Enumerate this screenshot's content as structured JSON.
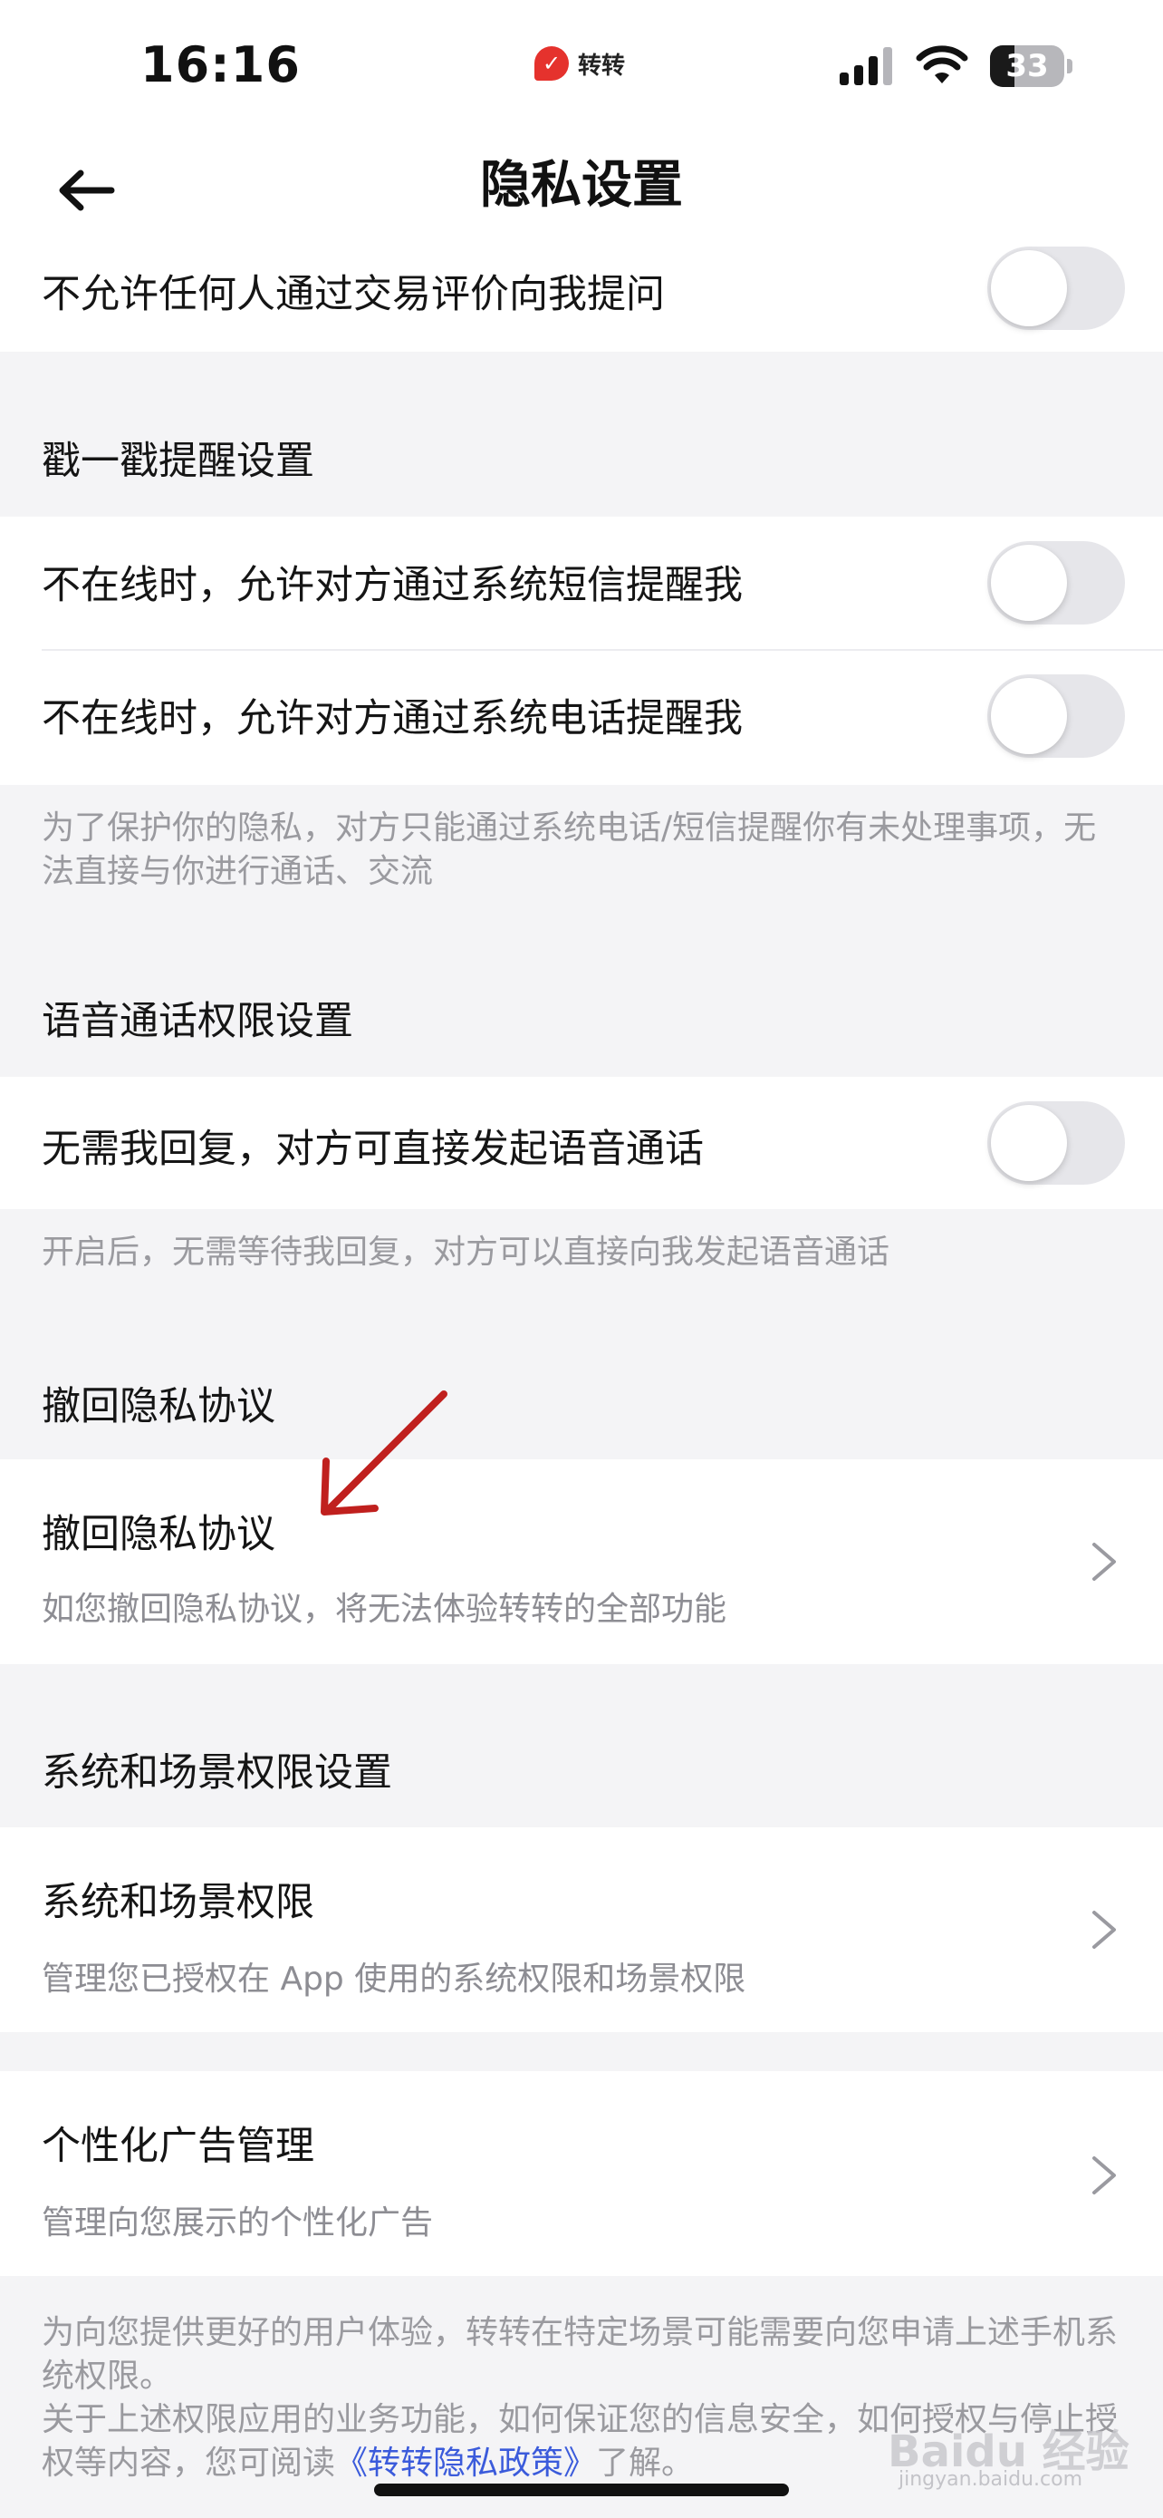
{
  "status_bar": {
    "time": "16:16",
    "app_name": "转转",
    "battery_level": "33",
    "battery_fraction": 0.33
  },
  "header": {
    "title": "隐私设置",
    "back_icon": "arrow-left-icon"
  },
  "rows": {
    "no_question": {
      "label": "不允许任何人通过交易评价向我提问",
      "enabled": false
    },
    "poke_title": "戳一戳提醒设置",
    "sms_remind": {
      "label": "不在线时，允许对方通过系统短信提醒我",
      "enabled": false
    },
    "call_remind": {
      "label": "不在线时，允许对方通过系统电话提醒我",
      "enabled": false
    },
    "poke_note": "为了保护你的隐私，对方只能通过系统电话/短信提醒你有未处理事项，无法直接与你进行通话、交流",
    "voice_title": "语音通话权限设置",
    "voice_call": {
      "label": "无需我回复，对方可直接发起语音通话",
      "enabled": false
    },
    "voice_note": "开启后，无需等待我回复，对方可以直接向我发起语音通话",
    "revoke_title": "撤回隐私协议",
    "revoke": {
      "label": "撤回隐私协议",
      "sub": "如您撤回隐私协议，将无法体验转转的全部功能"
    },
    "system_title": "系统和场景权限设置",
    "system": {
      "label": "系统和场景权限",
      "sub": "管理您已授权在 App 使用的系统权限和场景权限"
    },
    "ads": {
      "label": "个性化广告管理",
      "sub": "管理向您展示的个性化广告"
    },
    "footer_note_1": "为向您提供更好的用户体验，转转在特定场景可能需要向您申请上述手机系统权限。",
    "footer_note_2_prefix": "关于上述权限应用的业务功能，如何保证您的信息安全，如何授权与停止授权等内容，您可阅读",
    "footer_link": "《转转隐私政策》",
    "footer_note_2_suffix": "了解。"
  },
  "watermark": {
    "text": "Baidu 经验",
    "sub": "jingyan.baidu.com"
  },
  "colors": {
    "background": "#f4f4f6",
    "annotation_arrow": "#c0201e",
    "link": "#3b5bdb"
  }
}
